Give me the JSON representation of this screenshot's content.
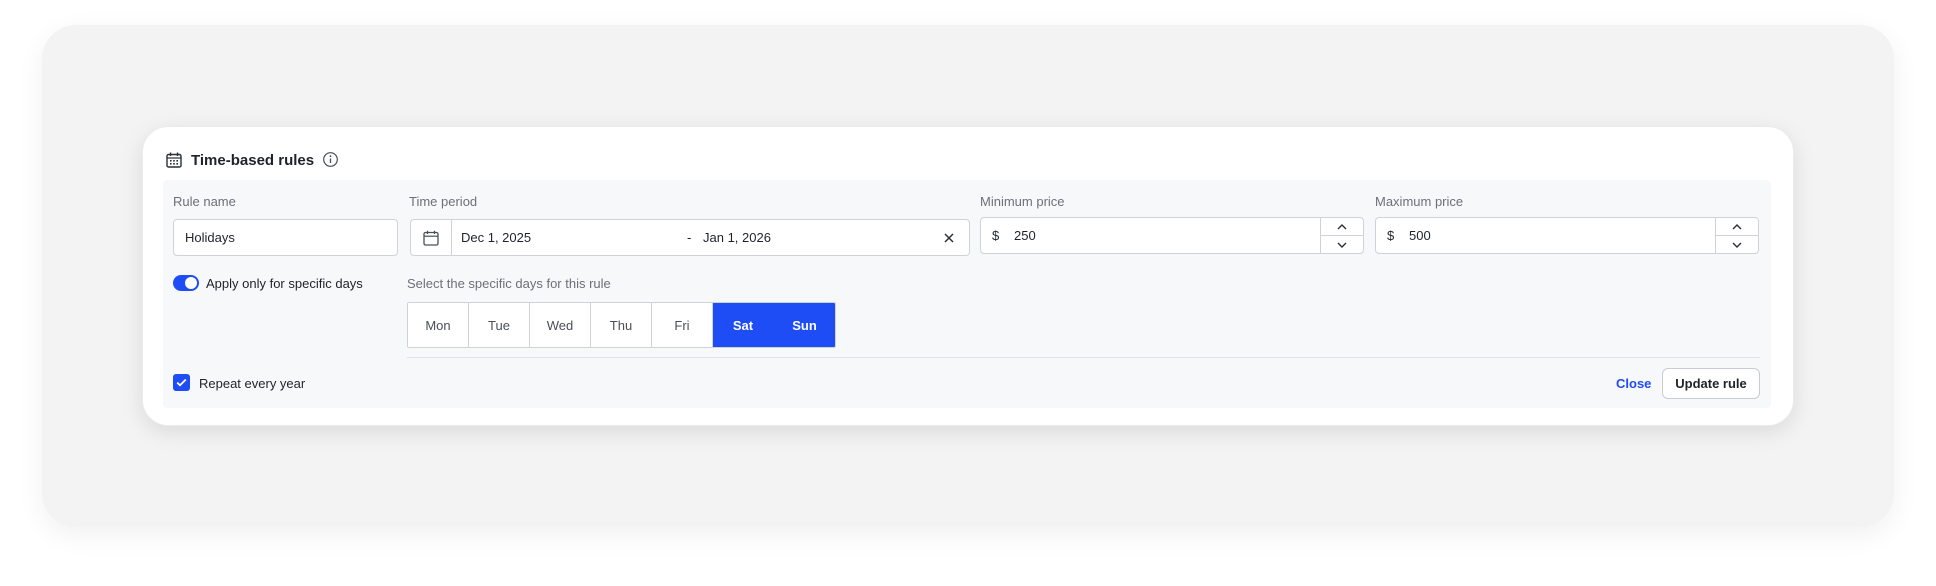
{
  "card": {
    "title": "Time-based rules"
  },
  "rule_name": {
    "label": "Rule name",
    "value": "Holidays"
  },
  "time_period": {
    "label": "Time period",
    "start": "Dec 1, 2025",
    "separator": "-",
    "end": "Jan 1, 2026"
  },
  "min_price": {
    "label": "Minimum price",
    "currency": "$",
    "value": "250"
  },
  "max_price": {
    "label": "Maximum price",
    "currency": "$",
    "value": "500"
  },
  "specific_days": {
    "toggle_label": "Apply only for specific days",
    "toggle_on": true,
    "select_label": "Select the specific days for this rule",
    "days": [
      {
        "label": "Mon",
        "selected": false
      },
      {
        "label": "Tue",
        "selected": false
      },
      {
        "label": "Wed",
        "selected": false
      },
      {
        "label": "Thu",
        "selected": false
      },
      {
        "label": "Fri",
        "selected": false
      },
      {
        "label": "Sat",
        "selected": true
      },
      {
        "label": "Sun",
        "selected": true
      }
    ]
  },
  "repeat": {
    "label": "Repeat every year",
    "checked": true
  },
  "actions": {
    "close_label": "Close",
    "update_label": "Update rule"
  },
  "colors": {
    "accent": "#1f4df5",
    "panel_bg": "#f3f3f3",
    "inner_bg": "#f7f8fa"
  },
  "icons": {
    "header": "calendar-grid-icon",
    "info": "info-icon",
    "date": "calendar-icon",
    "clear": "close-icon",
    "step_up": "chevron-up-icon",
    "step_down": "chevron-down-icon",
    "check": "check-icon"
  }
}
